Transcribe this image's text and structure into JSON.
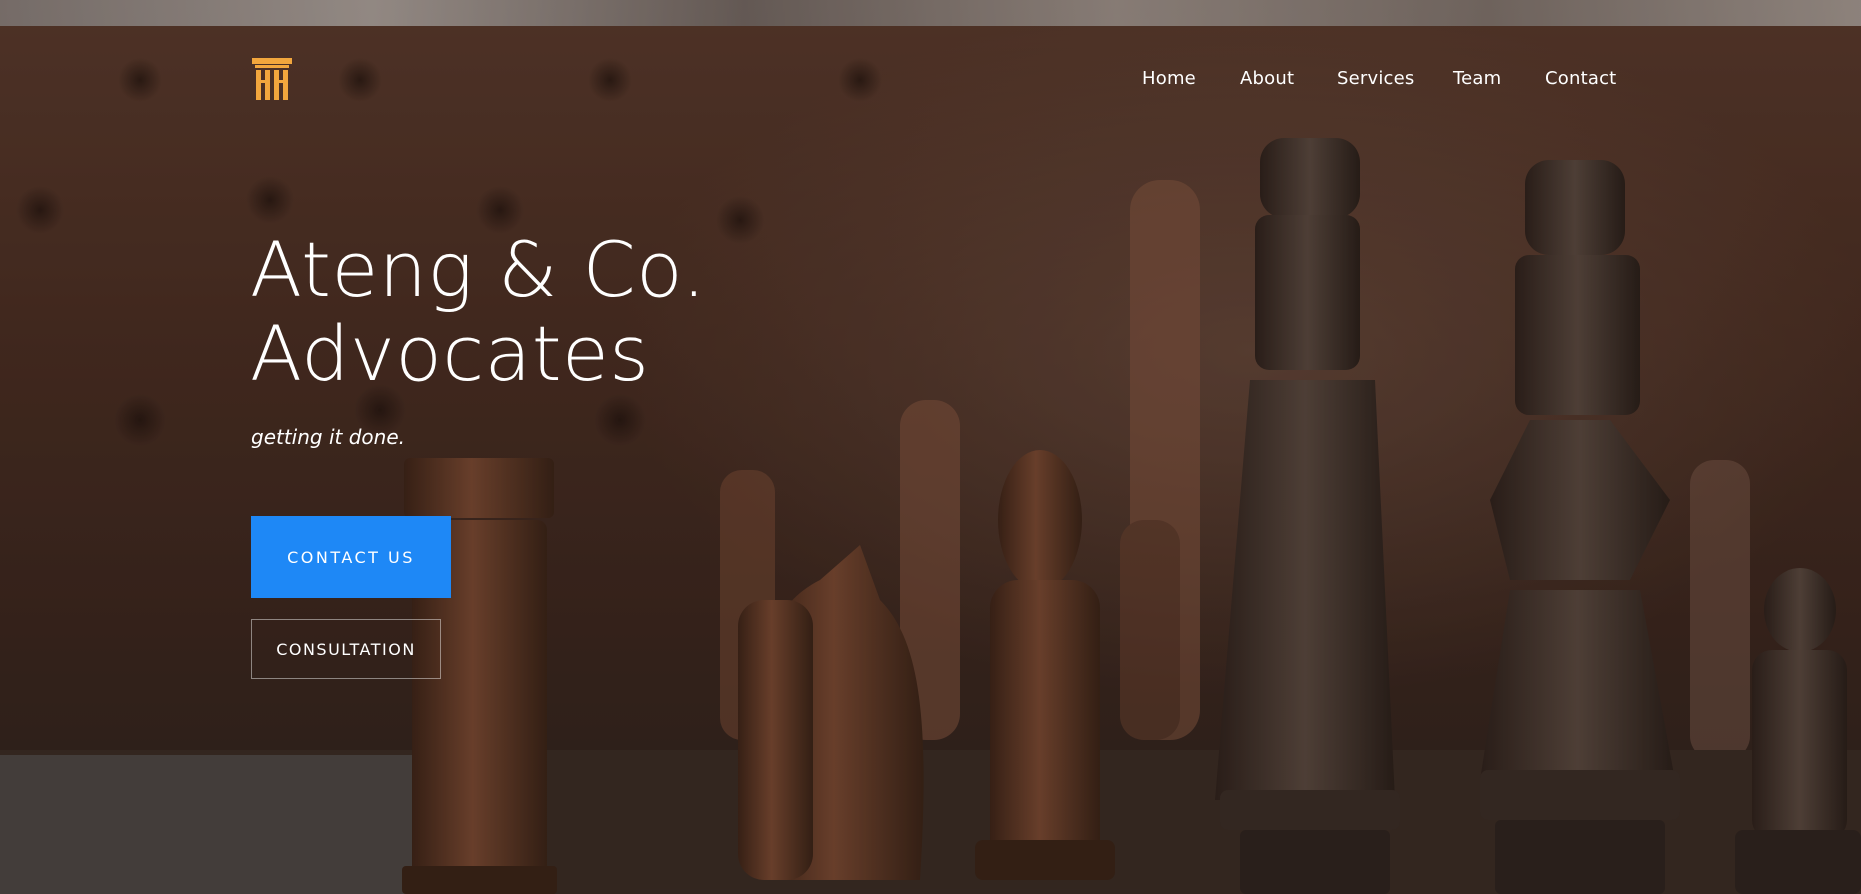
{
  "brand": {
    "logo_icon": "pillar-logo-icon",
    "logo_color": "#f2a63d"
  },
  "nav": {
    "items": [
      {
        "label": "Home"
      },
      {
        "label": "About"
      },
      {
        "label": "Services"
      },
      {
        "label": "Team"
      },
      {
        "label": "Contact"
      }
    ]
  },
  "hero": {
    "title_line1": "Ateng & Co.",
    "title_line2": "Advocates",
    "tagline": "getting it done.",
    "primary_button": "CONTACT US",
    "secondary_button": "CONSULTATION",
    "background_image": "chess-pieces-photo"
  },
  "colors": {
    "accent": "#1e88f6",
    "text": "#ffffff"
  }
}
